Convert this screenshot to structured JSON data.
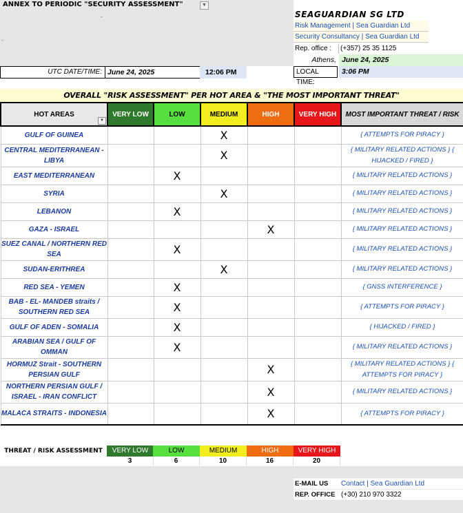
{
  "header": {
    "annex_title": "ANNEX TO PERIODIC \"SECURITY ASSESSMENT\"",
    "company_name": "SEAGUARDIAN SG LTD",
    "link_1": "Risk Management | Sea Guardian Ltd",
    "link_2": "Security Consultancy | Sea Guardian Ltd",
    "rep_office_label": "Rep. office :",
    "rep_office_phone": "(+357) 25 35 1125",
    "athens_label": "Athens,",
    "athens_date": "June 24, 2025",
    "local_time_label": "LOCAL TIME:",
    "local_time": "3:06 PM",
    "utc_label": "UTC DATE/TIME:",
    "utc_date": "June 24, 2025",
    "utc_time": "12:06 PM"
  },
  "overall_title": "OVERALL \"RISK ASSESSMENT\" PER HOT AREA & \"THE MOST IMPORTANT THREAT\"",
  "table": {
    "headers": {
      "hot_areas": "HOT AREAS",
      "very_low": "VERY LOW",
      "low": "LOW",
      "medium": "MEDIUM",
      "high": "HIGH",
      "very_high": "VERY HIGH",
      "threat": "MOST IMPORTANT THREAT / RISK"
    },
    "mark": "X",
    "rows": [
      {
        "area": "GULF OF GUINEA",
        "level": "medium",
        "threat": "{ ATTEMPTS FOR PIRACY }"
      },
      {
        "area": "CENTRAL MEDITERRANEAN - LIBYA",
        "level": "medium",
        "threat": "{ MILITARY RELATED ACTIONS } { HIJACKED / FIRED }"
      },
      {
        "area": "EAST MEDITERRANEAN",
        "level": "low",
        "threat": "{ MILITARY RELATED ACTIONS }"
      },
      {
        "area": "SYRIA",
        "level": "medium",
        "threat": "{ MILITARY RELATED ACTIONS }"
      },
      {
        "area": "LEBANON",
        "level": "low",
        "threat": "{ MILITARY RELATED ACTIONS }"
      },
      {
        "area": "GAZA - ISRAEL",
        "level": "high",
        "threat": "{ MILITARY RELATED ACTIONS }"
      },
      {
        "area": "SUEZ CANAL / NORTHERN RED SEA",
        "level": "low",
        "threat": "{ MILITARY RELATED ACTIONS }"
      },
      {
        "area": "SUDAN-ERITHREA",
        "level": "medium",
        "threat": "{ MILITARY RELATED ACTIONS }"
      },
      {
        "area": "RED SEA - YEMEN",
        "level": "low",
        "threat": "{ GNSS INTERFERENCE }"
      },
      {
        "area": "BAB - EL- MANDEB straits / SOUTHERN RED SEA",
        "level": "low",
        "threat": "{ ATTEMPTS FOR PIRACY }"
      },
      {
        "area": "GULF OF ADEN - SOMALIA",
        "level": "low",
        "threat": "{ HIJACKED / FIRED }"
      },
      {
        "area": "ARABIAN SEA / GULF OF OMMAN",
        "level": "low",
        "threat": "{ MILITARY RELATED ACTIONS }"
      },
      {
        "area": "HORMUZ Strait - SOUTHERN PERSIAN GULF",
        "level": "high",
        "threat": "{ MILITARY RELATED ACTIONS } { ATTEMPTS FOR PIRACY }"
      },
      {
        "area": "NORTHERN PERSIAN GULF / ISRAEL - IRAN CONFLICT",
        "level": "high",
        "threat": "{ MILITARY RELATED ACTIONS }"
      },
      {
        "area": "MALACA STRAITS - INDONESIA",
        "level": "high",
        "threat": "{ ATTEMPTS FOR PIRACY }"
      }
    ]
  },
  "legend": {
    "label": "THREAT / RISK ASSESSMENT",
    "items": [
      {
        "label": "VERY LOW",
        "value": "3",
        "color": "#2f7a2c",
        "text_color": "#ffffff"
      },
      {
        "label": "LOW",
        "value": "6",
        "color": "#55e040",
        "text_color": "#000000"
      },
      {
        "label": "MEDIUM",
        "value": "10",
        "color": "#f2ee1e",
        "text_color": "#000000"
      },
      {
        "label": "HIGH",
        "value": "16",
        "color": "#f06c11",
        "text_color": "#ffffff"
      },
      {
        "label": "VERY HIGH",
        "value": "20",
        "color": "#e8161b",
        "text_color": "#ffffff"
      }
    ]
  },
  "footer": {
    "email_label": "E-MAIL US",
    "email_value": "Contact | Sea Guardian Ltd",
    "rep_label": "REP. OFFICE",
    "rep_value": "(+30) 210 970 3322"
  }
}
